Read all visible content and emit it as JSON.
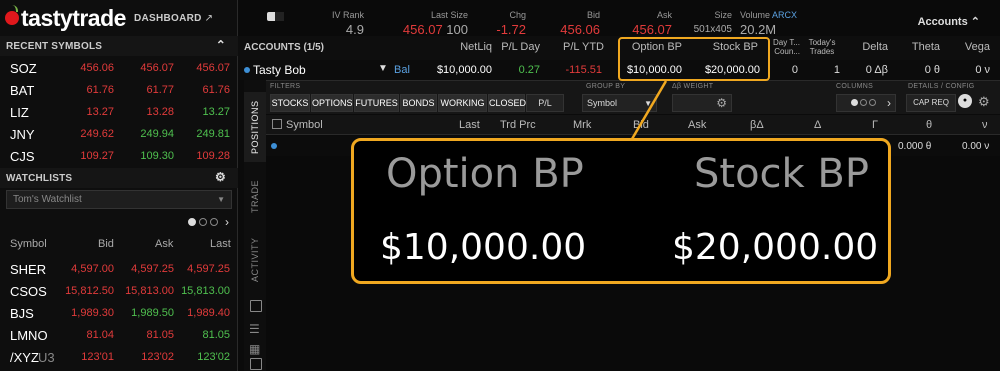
{
  "brand": {
    "logo": "tastytrade",
    "dashboard": "DASHBOARD"
  },
  "recent": {
    "title": "RECENT SYMBOLS",
    "rows": [
      {
        "sym": "SOZ",
        "a": "456.06",
        "b": "456.07",
        "c": "456.07",
        "ca": "red",
        "cb": "red",
        "cc": "red"
      },
      {
        "sym": "BAT",
        "a": "61.76",
        "b": "61.77",
        "c": "61.76",
        "ca": "red",
        "cb": "red",
        "cc": "red"
      },
      {
        "sym": "LIZ",
        "a": "13.27",
        "b": "13.28",
        "c": "13.27",
        "ca": "red",
        "cb": "red",
        "cc": "grn"
      },
      {
        "sym": "JNY",
        "a": "249.62",
        "b": "249.94",
        "c": "249.81",
        "ca": "red",
        "cb": "grn",
        "cc": "grn"
      },
      {
        "sym": "CJS",
        "a": "109.27",
        "b": "109.30",
        "c": "109.28",
        "ca": "red",
        "cb": "grn",
        "cc": "red"
      }
    ]
  },
  "watchlists": {
    "title": "WATCHLISTS",
    "selected": "Tom's Watchlist",
    "cols": {
      "symbol": "Symbol",
      "bid": "Bid",
      "ask": "Ask",
      "last": "Last"
    },
    "rows": [
      {
        "sym": "SHER",
        "a": "4,597.00",
        "b": "4,597.25",
        "c": "4,597.25",
        "ca": "red",
        "cb": "red",
        "cc": "red"
      },
      {
        "sym": "CSOS",
        "a": "15,812.50",
        "b": "15,813.00",
        "c": "15,813.00",
        "ca": "red",
        "cb": "red",
        "cc": "grn"
      },
      {
        "sym": "BJS",
        "a": "1,989.30",
        "b": "1,989.50",
        "c": "1,989.40",
        "ca": "red",
        "cb": "grn",
        "cc": "red"
      },
      {
        "sym": "LMNO",
        "a": "81.04",
        "b": "81.05",
        "c": "81.05",
        "ca": "red",
        "cb": "red",
        "cc": "grn"
      },
      {
        "sym": "/XYZ",
        "suffix": "U3",
        "a": "123'01",
        "b": "123'02",
        "c": "123'02",
        "ca": "red",
        "cb": "red",
        "cc": "grn"
      }
    ]
  },
  "quote": {
    "iv_rank_label": "IV Rank",
    "iv_rank": "4.9",
    "last_size_label": "Last Size",
    "last": "456.07",
    "last_size": "100",
    "chg_label": "Chg",
    "chg": "-1.72",
    "bid_label": "Bid",
    "bid": "456.06",
    "ask_label": "Ask",
    "ask": "456.07",
    "size_label": "Size",
    "size": "501x405",
    "volume_label": "Volume",
    "exchange": "ARCX",
    "volume": "20.2M",
    "accounts_btn": "Accounts"
  },
  "accounts": {
    "title": "ACCOUNTS (1/5)",
    "headers": {
      "netliq": "NetLiq",
      "pl_day": "P/L Day",
      "pl_ytd": "P/L YTD",
      "option_bp": "Option BP",
      "stock_bp": "Stock BP",
      "day_trade": "Day T... Coun...",
      "todays": "Today's Trades",
      "delta": "Delta",
      "theta": "Theta",
      "vega": "Vega"
    },
    "row": {
      "name": "Tasty Bob",
      "bal": "Bal",
      "netliq": "$10,000.00",
      "pl_day": "0.27",
      "pl_ytd": "-115.51",
      "option_bp": "$10,000.00",
      "stock_bp": "$20,000.00",
      "day_trade": "0",
      "todays": "1",
      "delta": "0 Δβ",
      "theta": "0 θ",
      "vega": "0 ν"
    }
  },
  "filters": {
    "filters_label": "FILTERS",
    "group_label": "GROUP BY",
    "beta_label": "Δβ WEIGHT",
    "columns_label": "COLUMNS",
    "details_label": "DETAILS / CONFIG",
    "buttons": [
      "STOCKS",
      "OPTIONS",
      "FUTURES",
      "BONDS",
      "WORKING",
      "CLOSED",
      "P/L"
    ],
    "group_value": "Symbol",
    "capreq": "CAP REQ"
  },
  "vtabs": {
    "positions": "POSITIONS",
    "trade": "TRADE",
    "activity": "ACTIVITY"
  },
  "positions": {
    "headers": [
      "Symbol",
      "Last",
      "Trd Prc",
      "Mrk",
      "Bid",
      "Ask",
      "βΔ",
      "Δ",
      "Γ",
      "θ",
      "ν"
    ],
    "theta_total": "0.000 θ",
    "vega_total": "0.00 ν"
  },
  "zoom": {
    "option_bp_label": "Option BP",
    "stock_bp_label": "Stock BP",
    "option_bp": "$10,000.00",
    "stock_bp": "$20,000.00"
  },
  "colors": {
    "accent": "#f0a820",
    "red": "#e23b3b",
    "green": "#4fc04f"
  }
}
